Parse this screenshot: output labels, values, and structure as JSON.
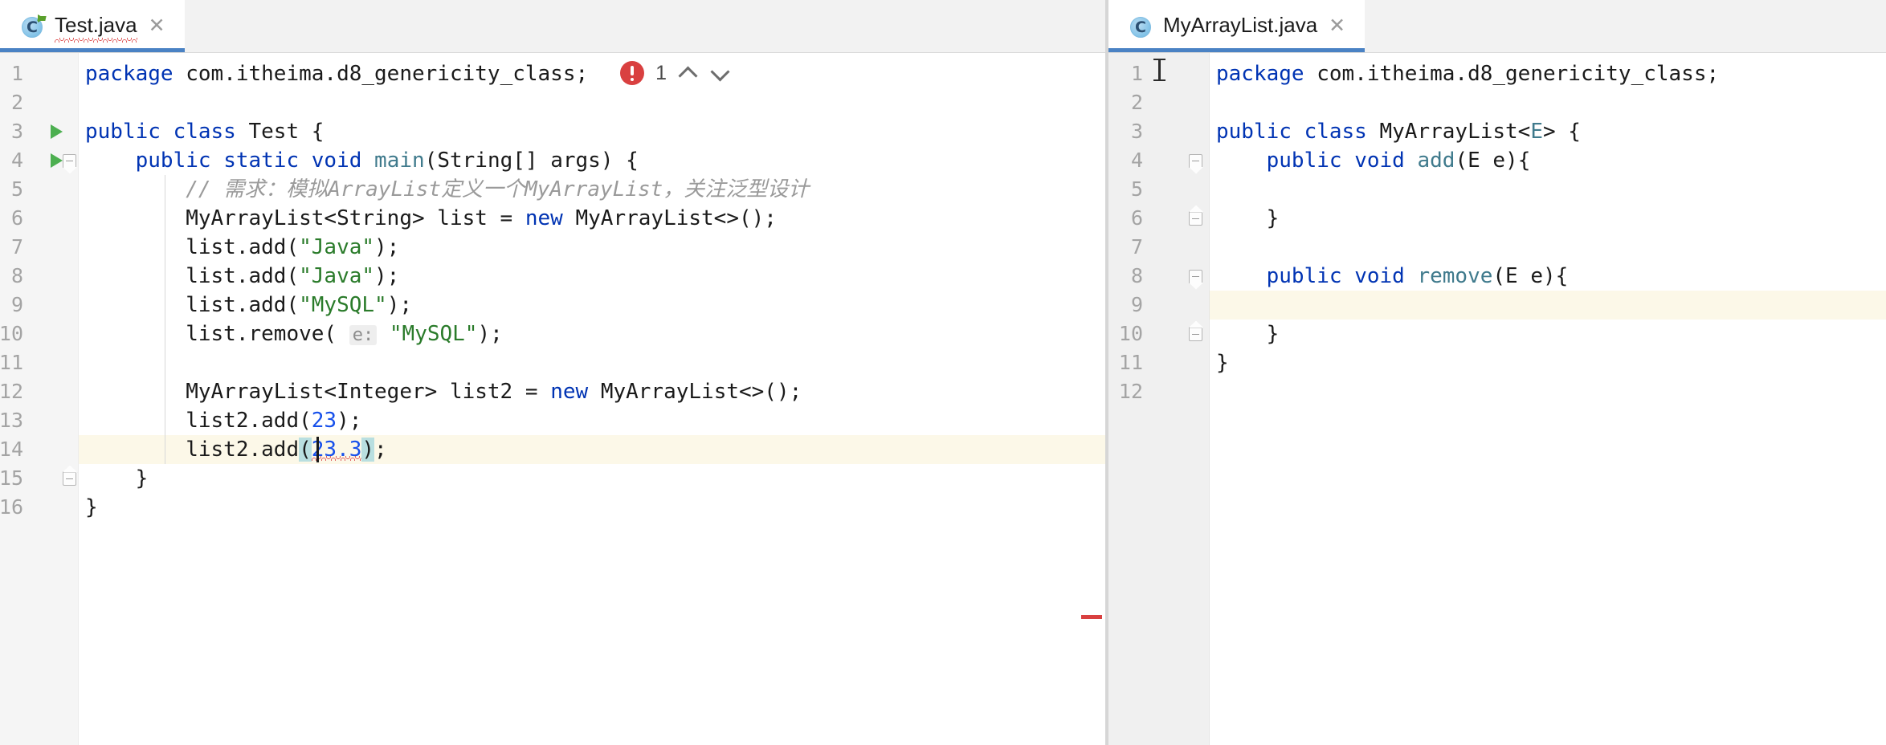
{
  "window": {
    "theme_accent": "#4a82c4",
    "error_color": "#d94040",
    "current_line_color": "#fdf6e3"
  },
  "left_pane": {
    "tab": {
      "label": "Test.java",
      "icon": "java-class-icon",
      "close_label": "✕",
      "has_error_underline": true,
      "active": true
    },
    "inspection_widget": {
      "error_count": "1",
      "prev_label": "∧",
      "next_label": "∨"
    },
    "line_numbers": [
      "1",
      "2",
      "3",
      "4",
      "5",
      "6",
      "7",
      "8",
      "9",
      "10",
      "11",
      "12",
      "13",
      "14",
      "15",
      "16"
    ],
    "current_line": 14,
    "run_markers": [
      3,
      4
    ],
    "fold_markers": [
      {
        "line": 4,
        "type": "start"
      },
      {
        "line": 15,
        "type": "end"
      }
    ],
    "code": [
      {
        "n": 1,
        "tokens": [
          {
            "t": "package",
            "c": "kw"
          },
          {
            "t": " com.itheima.d8_genericity_class;",
            "c": "plain"
          }
        ]
      },
      {
        "n": 2,
        "tokens": []
      },
      {
        "n": 3,
        "tokens": [
          {
            "t": "public class ",
            "c": "kw"
          },
          {
            "t": "Test",
            "c": "plain"
          },
          {
            "t": " {",
            "c": "plain"
          }
        ]
      },
      {
        "n": 4,
        "tokens": [
          {
            "t": "    ",
            "c": "plain"
          },
          {
            "t": "public static void ",
            "c": "kw"
          },
          {
            "t": "main",
            "c": "mth"
          },
          {
            "t": "(String[] args) {",
            "c": "plain"
          }
        ]
      },
      {
        "n": 5,
        "tokens": [
          {
            "t": "        ",
            "c": "plain"
          },
          {
            "t": "// 需求：模拟ArrayList定义一个MyArrayList，关注泛型设计",
            "c": "cmt"
          }
        ]
      },
      {
        "n": 6,
        "tokens": [
          {
            "t": "        MyArrayList<String> list = ",
            "c": "plain"
          },
          {
            "t": "new ",
            "c": "kw"
          },
          {
            "t": "MyArrayList<>();",
            "c": "plain"
          }
        ]
      },
      {
        "n": 7,
        "tokens": [
          {
            "t": "        list.add(",
            "c": "plain"
          },
          {
            "t": "\"Java\"",
            "c": "str"
          },
          {
            "t": ");",
            "c": "plain"
          }
        ]
      },
      {
        "n": 8,
        "tokens": [
          {
            "t": "        list.add(",
            "c": "plain"
          },
          {
            "t": "\"Java\"",
            "c": "str"
          },
          {
            "t": ");",
            "c": "plain"
          }
        ]
      },
      {
        "n": 9,
        "tokens": [
          {
            "t": "        list.add(",
            "c": "plain"
          },
          {
            "t": "\"MySQL\"",
            "c": "str"
          },
          {
            "t": ");",
            "c": "plain"
          }
        ]
      },
      {
        "n": 10,
        "tokens": [
          {
            "t": "        list.remove( ",
            "c": "plain"
          },
          {
            "t": "e:",
            "c": "hint"
          },
          {
            "t": " ",
            "c": "plain"
          },
          {
            "t": "\"MySQL\"",
            "c": "str"
          },
          {
            "t": ");",
            "c": "plain"
          }
        ]
      },
      {
        "n": 11,
        "tokens": []
      },
      {
        "n": 12,
        "tokens": [
          {
            "t": "        MyArrayList<Integer> list2 = ",
            "c": "plain"
          },
          {
            "t": "new ",
            "c": "kw"
          },
          {
            "t": "MyArrayList<>();",
            "c": "plain"
          }
        ]
      },
      {
        "n": 13,
        "tokens": [
          {
            "t": "        list2.add(",
            "c": "plain"
          },
          {
            "t": "23",
            "c": "num"
          },
          {
            "t": ");",
            "c": "plain"
          }
        ]
      },
      {
        "n": 14,
        "tokens": [
          {
            "t": "        list2.add",
            "c": "plain"
          },
          {
            "t": "(",
            "c": "brk"
          },
          {
            "t": "23.3",
            "c": "num-err"
          },
          {
            "t": ")",
            "c": "brk"
          },
          {
            "t": ";",
            "c": "plain"
          }
        ]
      },
      {
        "n": 15,
        "tokens": [
          {
            "t": "    }",
            "c": "plain"
          }
        ]
      },
      {
        "n": 16,
        "tokens": [
          {
            "t": "}",
            "c": "plain"
          }
        ]
      }
    ]
  },
  "right_pane": {
    "tab": {
      "label": "MyArrayList.java",
      "icon": "java-class-icon",
      "close_label": "✕",
      "has_error_underline": false,
      "active": true
    },
    "line_numbers": [
      "1",
      "2",
      "3",
      "4",
      "5",
      "6",
      "7",
      "8",
      "9",
      "10",
      "11",
      "12"
    ],
    "current_line": 9,
    "fold_markers": [
      {
        "line": 4,
        "type": "start"
      },
      {
        "line": 6,
        "type": "end"
      },
      {
        "line": 8,
        "type": "start"
      },
      {
        "line": 10,
        "type": "end"
      }
    ],
    "code": [
      {
        "n": 1,
        "tokens": [
          {
            "t": "package",
            "c": "kw"
          },
          {
            "t": " com.itheima.d8_genericity_class;",
            "c": "plain"
          }
        ]
      },
      {
        "n": 2,
        "tokens": []
      },
      {
        "n": 3,
        "tokens": [
          {
            "t": "public class ",
            "c": "kw"
          },
          {
            "t": "MyArrayList<",
            "c": "plain"
          },
          {
            "t": "E",
            "c": "mth"
          },
          {
            "t": "> {",
            "c": "plain"
          }
        ]
      },
      {
        "n": 4,
        "tokens": [
          {
            "t": "    ",
            "c": "plain"
          },
          {
            "t": "public void ",
            "c": "kw"
          },
          {
            "t": "add",
            "c": "mth"
          },
          {
            "t": "(E e){",
            "c": "plain"
          }
        ]
      },
      {
        "n": 5,
        "tokens": []
      },
      {
        "n": 6,
        "tokens": [
          {
            "t": "    }",
            "c": "plain"
          }
        ]
      },
      {
        "n": 7,
        "tokens": []
      },
      {
        "n": 8,
        "tokens": [
          {
            "t": "    ",
            "c": "plain"
          },
          {
            "t": "public void ",
            "c": "kw"
          },
          {
            "t": "remove",
            "c": "mth"
          },
          {
            "t": "(E e){",
            "c": "plain"
          }
        ]
      },
      {
        "n": 9,
        "tokens": []
      },
      {
        "n": 10,
        "tokens": [
          {
            "t": "    }",
            "c": "plain"
          }
        ]
      },
      {
        "n": 11,
        "tokens": [
          {
            "t": "}",
            "c": "plain"
          }
        ]
      },
      {
        "n": 12,
        "tokens": []
      }
    ]
  }
}
